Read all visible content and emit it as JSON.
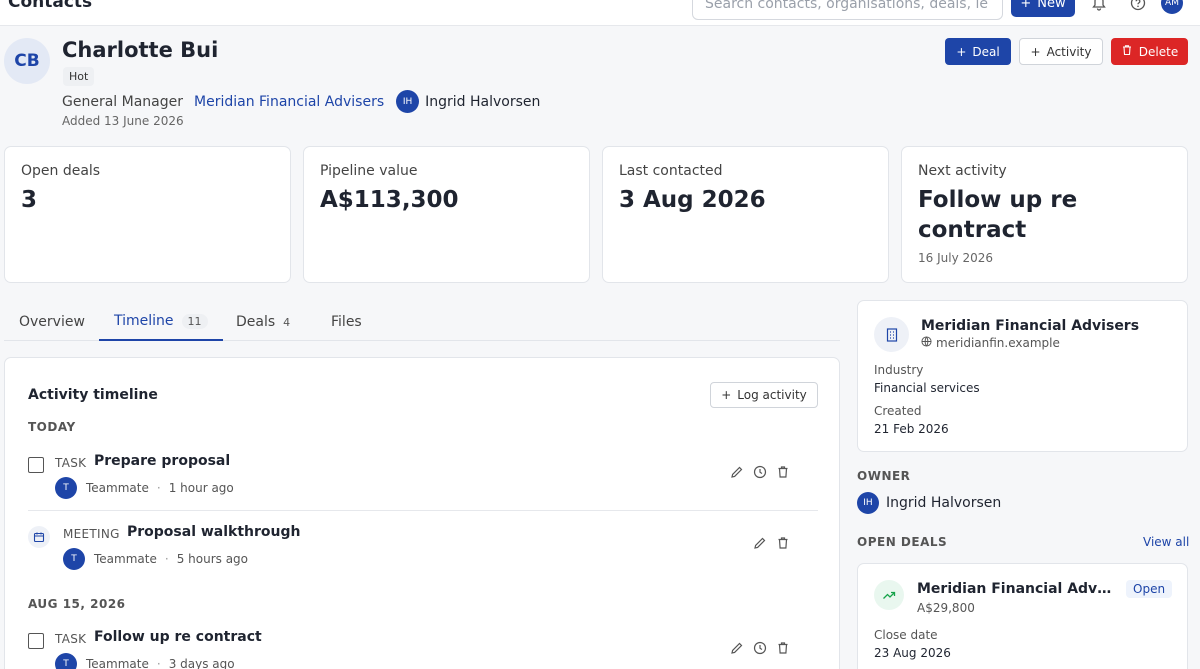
{
  "topbar": {
    "title": "Contacts",
    "search_placeholder": "Search contacts, organisations, deals, le",
    "new_label": "New",
    "user_initials": "AM"
  },
  "contact": {
    "initials": "CB",
    "name": "Charlotte Bui",
    "tag": "Hot",
    "role": "General Manager",
    "organisation": "Meridian Financial Advisers",
    "owner_initials": "IH",
    "owner_name": "Ingrid Halvorsen",
    "added": "Added 13 June 2026"
  },
  "actions": {
    "deal": "Deal",
    "activity": "Activity",
    "delete": "Delete"
  },
  "stats": [
    {
      "label": "Open deals",
      "value": "3",
      "sub": ""
    },
    {
      "label": "Pipeline value",
      "value": "A$113,300",
      "sub": ""
    },
    {
      "label": "Last contacted",
      "value": "3 Aug 2026",
      "sub": ""
    },
    {
      "label": "Next activity",
      "value": "Follow up re contract",
      "sub": "16 July 2026"
    }
  ],
  "tabs": [
    {
      "label": "Overview",
      "count": ""
    },
    {
      "label": "Timeline",
      "count": "11"
    },
    {
      "label": "Deals",
      "count": "4"
    },
    {
      "label": "Files",
      "count": ""
    }
  ],
  "timeline": {
    "title": "Activity timeline",
    "log_label": "Log activity",
    "groups": [
      {
        "heading": "TODAY"
      },
      {
        "heading": "AUG 15, 2026"
      }
    ],
    "items": [
      {
        "type": "TASK",
        "title": "Prepare proposal",
        "avatar": "T",
        "author": "Teammate",
        "time": "1 hour ago"
      },
      {
        "type": "MEETING",
        "title": "Proposal walkthrough",
        "avatar": "T",
        "author": "Teammate",
        "time": "5 hours ago"
      },
      {
        "type": "TASK",
        "title": "Follow up re contract",
        "avatar": "T",
        "author": "Teammate",
        "time": "3 days ago"
      }
    ]
  },
  "organisation": {
    "name": "Meridian Financial Advisers",
    "website": "meridianfin.example",
    "industry_label": "Industry",
    "industry": "Financial services",
    "created_label": "Created",
    "created": "21 Feb 2026"
  },
  "owner": {
    "heading": "OWNER",
    "initials": "IH",
    "name": "Ingrid Halvorsen"
  },
  "open_deals": {
    "heading": "OPEN DEALS",
    "view_all": "View all",
    "deal": {
      "name": "Meridian Financial Advisers",
      "amount": "A$29,800",
      "status": "Open",
      "close_label": "Close date",
      "close_date": "23 Aug 2026"
    }
  },
  "colors": {
    "primary": "#1e45a8",
    "danger": "#dc2626"
  }
}
